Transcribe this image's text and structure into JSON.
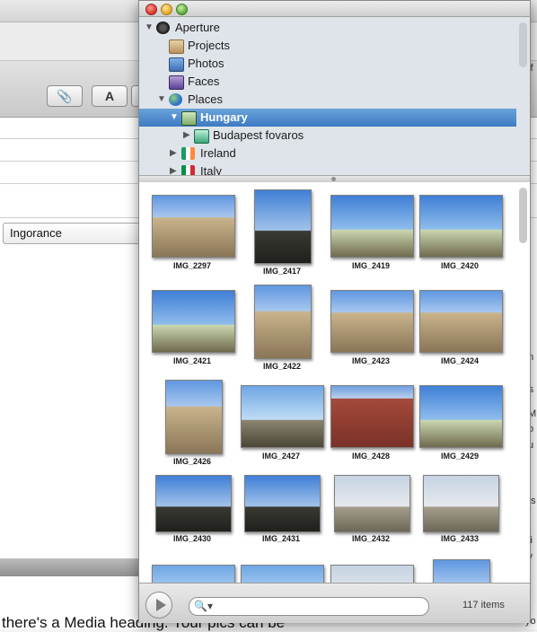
{
  "background_window": {
    "select_value": "Ingorance",
    "caption_text": "there's a Media heading. Your pics can be",
    "toolbar_glyphs": [
      "📎",
      "A",
      "▭"
    ],
    "right_fragments": [
      "tif",
      "m",
      "o a",
      "rs",
      "IMI",
      "to",
      "tu",
      "?",
      "es",
      "vi",
      "ly",
      "n",
      "i",
      "yo"
    ]
  },
  "media_browser": {
    "sources": [
      {
        "label": "Aperture",
        "expanded": true,
        "icon": "aperture-icon"
      },
      {
        "label": "Projects",
        "icon": "projects-icon"
      },
      {
        "label": "Photos",
        "icon": "photos-icon"
      },
      {
        "label": "Faces",
        "icon": "faces-icon"
      },
      {
        "label": "Places",
        "expanded": true,
        "icon": "globe-icon"
      },
      {
        "label": "Hungary",
        "expanded": true,
        "selected": true,
        "icon": "flag-hungary-icon"
      },
      {
        "label": "Budapest fovaros",
        "icon": "map-pin-icon"
      },
      {
        "label": "Ireland",
        "icon": "flag-ireland-icon"
      },
      {
        "label": "Italy",
        "icon": "flag-italy-icon"
      }
    ],
    "photos": [
      "IMG_2297",
      "IMG_2417",
      "IMG_2419",
      "IMG_2420",
      "IMG_2421",
      "IMG_2422",
      "IMG_2423",
      "IMG_2424",
      "IMG_2426",
      "IMG_2427",
      "IMG_2428",
      "IMG_2429",
      "IMG_2430",
      "IMG_2431",
      "IMG_2432",
      "IMG_2433"
    ],
    "search": {
      "value": "",
      "placeholder": ""
    },
    "item_count": "117 items"
  }
}
